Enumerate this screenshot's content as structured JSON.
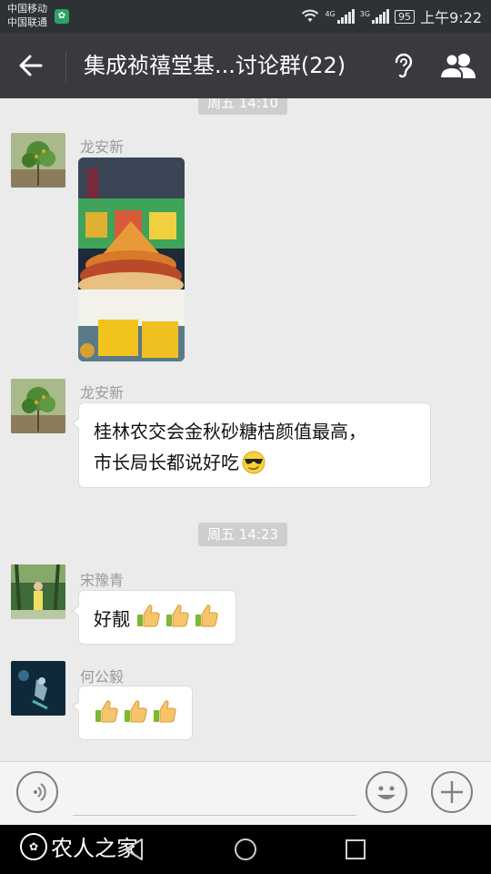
{
  "status_bar": {
    "carrier_1": "中国移动",
    "carrier_2": "中国联通",
    "signal_1_tag": "4G",
    "signal_2_tag": "3G",
    "battery": "95",
    "time": "上午9:22"
  },
  "header": {
    "title": "集成祯禧堂基...讨论群(22)",
    "back_icon": "arrow-left-icon",
    "ear_icon": "ear-icon",
    "members_icon": "group-members-icon"
  },
  "chat": {
    "timestamps": [
      "周五 14:10",
      "周五 14:23"
    ],
    "messages": [
      {
        "sender": "龙安新",
        "type": "image",
        "image_desc": "orange-fruit-display-photo"
      },
      {
        "sender": "龙安新",
        "type": "text",
        "lines": [
          "桂林农交会金秋砂糖桔颜值最高，",
          "市长局长都说好吃"
        ],
        "emoji": "sunglasses-face"
      },
      {
        "sender": "宋豫青",
        "type": "text",
        "text": "好靓",
        "emoji_count": 3,
        "emoji": "thumbs-up"
      },
      {
        "sender": "何公毅",
        "type": "emoji",
        "emoji_count": 3,
        "emoji": "thumbs-up"
      }
    ]
  },
  "input_bar": {
    "voice_icon": "voice-icon",
    "emoji_icon": "smiley-icon",
    "plus_icon": "plus-icon",
    "input_value": ""
  },
  "watermark": {
    "text": "农人之家"
  },
  "colors": {
    "title_bar": "#393a3f",
    "status_bar": "#2f3235",
    "chat_bg": "#ebebeb",
    "timestamp_bg": "#cecece"
  }
}
